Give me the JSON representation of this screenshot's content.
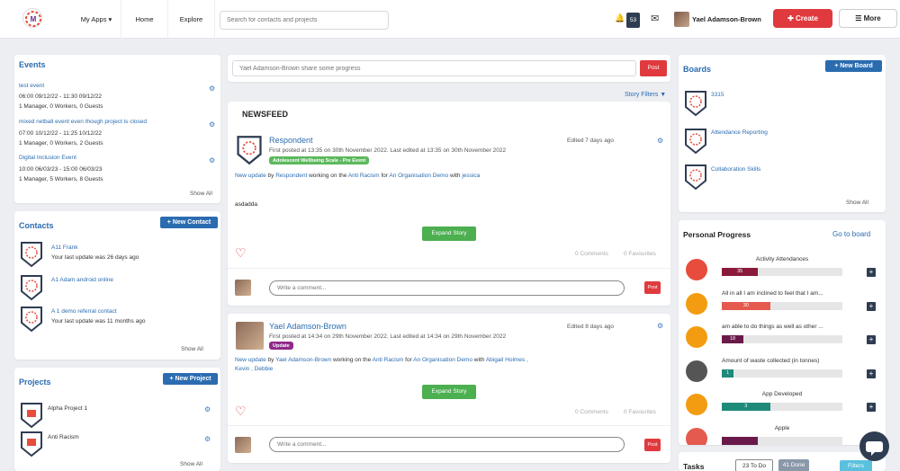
{
  "nav": {
    "my_apps": "My Apps ▾",
    "home": "Home",
    "explore": "Explore",
    "search_placeholder": "Search for contacts and projects",
    "notification_count": "53",
    "user_name": "Yael Adamson-Brown",
    "create": "✚ Create",
    "more": "☰ More"
  },
  "events": {
    "title": "Events",
    "items": [
      {
        "name": "test event",
        "time": "06:00 09/12/22 - 11:30 09/12/22",
        "people": "1 Manager, 0 Workers, 0 Guests"
      },
      {
        "name": "mixed netball event even though project is closed",
        "time": "07:00 10/12/22 - 11:25 10/12/22",
        "people": "1 Manager, 0 Workers, 2 Guests"
      },
      {
        "name": "Digital Inclusion Event",
        "time": "10:00 06/03/23 - 15:00 06/03/23",
        "people": "1 Manager, 5 Workers, 8 Guests"
      }
    ],
    "show_all": "Show All"
  },
  "contacts": {
    "title": "Contacts",
    "new_button": "+ New Contact",
    "items": [
      {
        "name": "A11 Frank",
        "update": "Your last update was 26 days ago"
      },
      {
        "name": "A1 Adam android online",
        "update": ""
      },
      {
        "name": "A 1 demo referral contact",
        "update": "Your last update was 11 months ago"
      }
    ],
    "show_all": "Show All"
  },
  "projects": {
    "title": "Projects",
    "new_button": "+ New Project",
    "items": [
      {
        "name": "Alpha Project 1"
      },
      {
        "name": "Anti Racism"
      }
    ],
    "show_all": "Show All"
  },
  "feed": {
    "share_placeholder": "Yael Adamson-Brown share some progress",
    "post": "Post",
    "story_filters": "Story Filters ▼",
    "newsfeed": "NEWSFEED",
    "stories": [
      {
        "author": "Respondent",
        "posted": "First posted at 13:35 on 30th November 2022. Last edited at 13:35 on 30th November 2022",
        "edited": "Edited 7 days ago",
        "tag": "Adolescent Wellbeing Scale - Pre Event",
        "line_a": "New update",
        "line_b": "by",
        "line_c": "Respondent",
        "line_d": "working on the",
        "line_e": "Anti Racism",
        "line_f": "for",
        "line_g": "An Organisation Demo",
        "line_h": "with",
        "line_i": "jessica",
        "body": "asdadda",
        "expand": "Expand Story",
        "comments": "0 Comments",
        "favourites": "0 Favourites",
        "comment_placeholder": "Write a comment...",
        "post": "Post"
      },
      {
        "author": "Yael Adamson-Brown",
        "posted": "First posted at 14:34 on 29th November 2022. Last edited at 14:34 on 29th November 2022",
        "edited": "Edited 8 days ago",
        "tag": "Update",
        "line_a": "New update",
        "line_b": "by",
        "line_c": "Yael Adamson-Brown",
        "line_d": "working on the",
        "line_e": "Anti Racism",
        "line_f": "for",
        "line_g": "An Organisation Demo",
        "line_h": "with",
        "line_i": "Abigail Holmes , Kevin , Debbie",
        "expand": "Expand Story",
        "comments": "0 Comments",
        "favourites": "0 Favourites",
        "comment_placeholder": "Write a comment...",
        "post": "Post"
      }
    ]
  },
  "boards": {
    "title": "Boards",
    "new_button": "+ New Board",
    "items": [
      {
        "name": "3315"
      },
      {
        "name": "Attendance Reporting"
      },
      {
        "name": "Collaboration Skills"
      }
    ],
    "show_all": "Show All"
  },
  "personal_progress": {
    "title": "Personal Progress",
    "go_to_board": "Go to board",
    "items": [
      {
        "label": "Activity Attendances",
        "value": "35",
        "fill": 0.3,
        "color": "#8b1a3a",
        "icon_color": "#e74c3c"
      },
      {
        "label": "All in all I am inclined to feel that I am...",
        "value": "30",
        "fill": 0.4,
        "color": "#e55a4e",
        "icon_color": "#f39c12"
      },
      {
        "label": "am able to do things as well as other ...",
        "value": "18",
        "fill": 0.18,
        "color": "#6a1a4a",
        "icon_color": "#f39c12"
      },
      {
        "label": "Amount of waste collected (in tonnes)",
        "value": "1",
        "fill": 0.1,
        "color": "#1e8a7a",
        "icon_color": "#555555"
      },
      {
        "label": "App Developed",
        "value": "3",
        "fill": 0.4,
        "color": "#1e8a7a",
        "icon_color": "#f39c12"
      },
      {
        "label": "Apple",
        "value": "",
        "fill": 0.3,
        "color": "#6a1a4a",
        "icon_color": "#e55a4e"
      }
    ]
  },
  "tasks": {
    "title": "Tasks",
    "todo": "23 To Do",
    "done": "41 Done",
    "filters": "Filters"
  }
}
